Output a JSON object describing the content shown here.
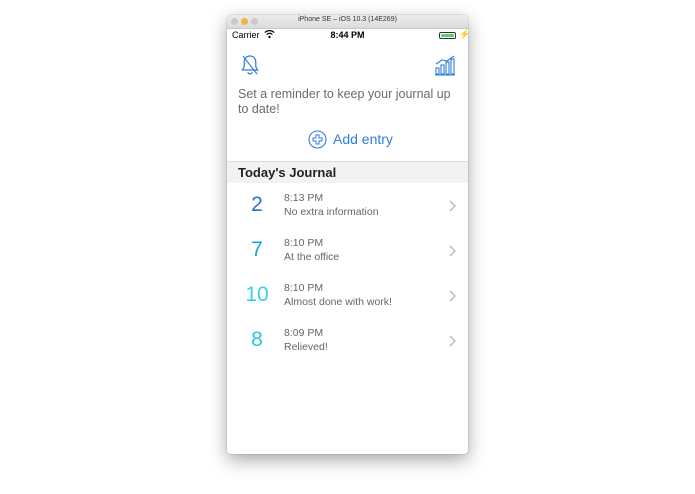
{
  "window": {
    "title": "iPhone SE – iOS 10.3 (14E269)"
  },
  "status_bar": {
    "carrier": "Carrier",
    "time": "8:44 PM",
    "battery_level": 1.0
  },
  "toolbar": {
    "left_icon": "bell-slash-icon",
    "right_icon": "bar-chart-icon"
  },
  "reminder": {
    "text": "Set a reminder to keep your journal up to date!"
  },
  "add_entry": {
    "label": "Add entry",
    "icon": "plus-circle-icon"
  },
  "journal": {
    "title": "Today's Journal",
    "entries": [
      {
        "score": "2",
        "time": "8:13 PM",
        "note": "No extra information",
        "color": "#2d6fd1"
      },
      {
        "score": "7",
        "time": "8:10 PM",
        "note": "At the office",
        "color": "#1ea3d8"
      },
      {
        "score": "10",
        "time": "8:10 PM",
        "note": "Almost done with work!",
        "color": "#36d3ea"
      },
      {
        "score": "8",
        "time": "8:09 PM",
        "note": "Relieved!",
        "color": "#2cc3df"
      }
    ]
  },
  "colors": {
    "accent": "#2f7ed8",
    "battery": "#4cd964"
  }
}
